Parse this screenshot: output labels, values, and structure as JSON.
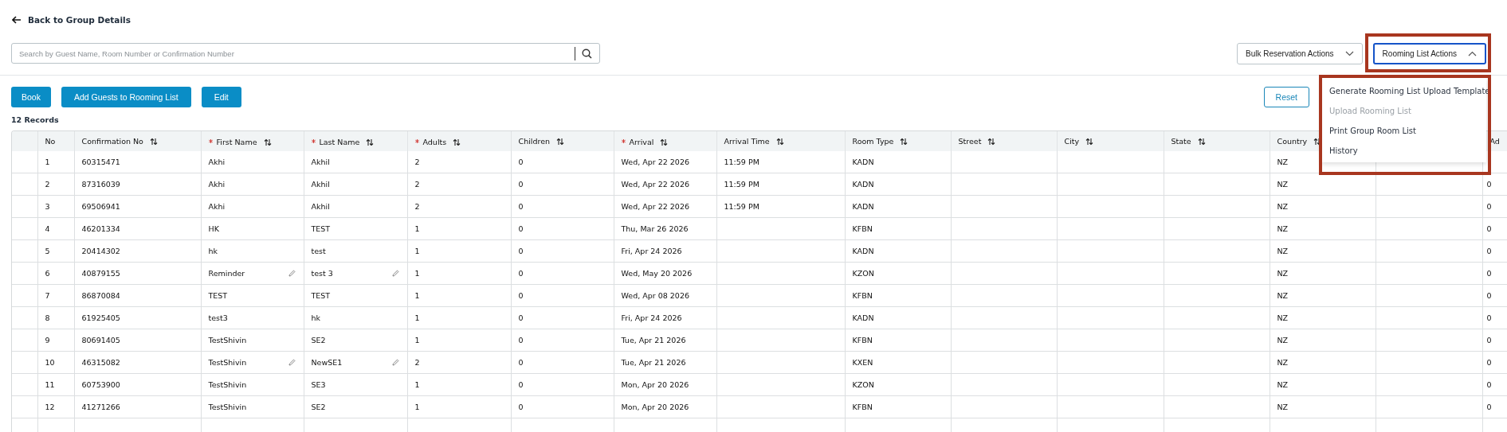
{
  "back_link": "Back to Group Details",
  "search": {
    "placeholder": "Search by Guest Name, Room Number or Confirmation Number"
  },
  "dropdowns": [
    {
      "label": "Bulk Reservation Actions",
      "expanded": false
    },
    {
      "label": "Rooming List Actions",
      "expanded": true
    }
  ],
  "menu": [
    {
      "label": "Generate Rooming List Upload Template",
      "disabled": false
    },
    {
      "label": "Upload Rooming List",
      "disabled": true
    },
    {
      "label": "Print Group Room List",
      "disabled": false
    },
    {
      "label": "History",
      "disabled": false
    }
  ],
  "buttons": [
    "Book",
    "Add Guests to Rooming List",
    "Edit"
  ],
  "reset_button": "Reset",
  "record_count": "12 Records",
  "table": {
    "columns": [
      {
        "label": "No",
        "required": false,
        "sortable": false
      },
      {
        "label": "Confirmation No",
        "required": false,
        "sortable": true
      },
      {
        "label": "First Name",
        "required": true,
        "sortable": true
      },
      {
        "label": "Last Name",
        "required": true,
        "sortable": true
      },
      {
        "label": "Adults",
        "required": true,
        "sortable": true
      },
      {
        "label": "Children",
        "required": false,
        "sortable": true
      },
      {
        "label": "Arrival",
        "required": true,
        "sortable": true
      },
      {
        "label": "Arrival Time",
        "required": false,
        "sortable": true
      },
      {
        "label": "Room Type",
        "required": false,
        "sortable": true
      },
      {
        "label": "Street",
        "required": false,
        "sortable": true
      },
      {
        "label": "City",
        "required": false,
        "sortable": true
      },
      {
        "label": "State",
        "required": false,
        "sortable": true
      },
      {
        "label": "Country",
        "required": false,
        "sortable": true
      },
      {
        "label": "Ad",
        "required": false
      }
    ],
    "rows": [
      {
        "no": "1",
        "confirmation_no": "60315471",
        "first_name": "Akhi",
        "last_name": "Akhil",
        "adults": "2",
        "children": "0",
        "arrival": "Wed, Apr 22 2026",
        "arrival_time": "11:59 PM",
        "room_type": "KADN",
        "country": "NZ",
        "editable": false
      },
      {
        "no": "2",
        "confirmation_no": "87316039",
        "first_name": "Akhi",
        "last_name": "Akhil",
        "adults": "2",
        "children": "0",
        "arrival": "Wed, Apr 22 2026",
        "arrival_time": "11:59 PM",
        "room_type": "KADN",
        "country": "NZ",
        "column_15": "0",
        "editable": false
      },
      {
        "no": "3",
        "confirmation_no": "69506941",
        "first_name": "Akhi",
        "last_name": "Akhil",
        "adults": "2",
        "children": "0",
        "arrival": "Wed, Apr 22 2026",
        "arrival_time": "11:59 PM",
        "room_type": "KADN",
        "country": "NZ",
        "column_15": "0",
        "editable": false
      },
      {
        "no": "4",
        "confirmation_no": "46201334",
        "first_name": "HK",
        "last_name": "TEST",
        "adults": "1",
        "children": "0",
        "arrival": "Thu, Mar 26 2026",
        "room_type": "KFBN",
        "country": "NZ",
        "column_15": "0",
        "editable": false
      },
      {
        "no": "5",
        "confirmation_no": "20414302",
        "first_name": "hk",
        "last_name": "test",
        "adults": "1",
        "children": "0",
        "arrival": "Fri, Apr 24 2026",
        "room_type": "KADN",
        "country": "NZ",
        "column_15": "0",
        "editable": false
      },
      {
        "no": "6",
        "confirmation_no": "40879155",
        "first_name": "Reminder",
        "last_name": "test 3",
        "adults": "1",
        "children": "0",
        "arrival": "Wed, May 20 2026",
        "room_type": "KZON",
        "country": "NZ",
        "column_15": "0",
        "editable": true
      },
      {
        "no": "7",
        "confirmation_no": "86870084",
        "first_name": "TEST",
        "last_name": "TEST",
        "adults": "1",
        "children": "0",
        "arrival": "Wed, Apr 08 2026",
        "room_type": "KFBN",
        "country": "NZ",
        "column_15": "0",
        "editable": false
      },
      {
        "no": "8",
        "confirmation_no": "61925405",
        "first_name": "test3",
        "last_name": "hk",
        "adults": "1",
        "children": "0",
        "arrival": "Fri, Apr 24 2026",
        "room_type": "KADN",
        "country": "NZ",
        "column_15": "0",
        "editable": false
      },
      {
        "no": "9",
        "confirmation_no": "80691405",
        "first_name": "TestShivin",
        "last_name": "SE2",
        "adults": "1",
        "children": "0",
        "arrival": "Tue, Apr 21 2026",
        "room_type": "KFBN",
        "country": "NZ",
        "column_15": "0",
        "editable": false
      },
      {
        "no": "10",
        "confirmation_no": "46315082",
        "first_name": "TestShivin",
        "last_name": "NewSE1",
        "adults": "2",
        "children": "0",
        "arrival": "Tue, Apr 21 2026",
        "room_type": "KXEN",
        "country": "NZ",
        "column_15": "0",
        "editable": true
      },
      {
        "no": "11",
        "confirmation_no": "60753900",
        "first_name": "TestShivin",
        "last_name": "SE3",
        "adults": "1",
        "children": "0",
        "arrival": "Mon, Apr 20 2026",
        "room_type": "KZON",
        "country": "NZ",
        "column_15": "0",
        "editable": false
      },
      {
        "no": "12",
        "confirmation_no": "41271266",
        "first_name": "TestShivin",
        "last_name": "SE2",
        "adults": "1",
        "children": "0",
        "arrival": "Mon, Apr 20 2026",
        "room_type": "KFBN",
        "country": "NZ",
        "column_15": "0",
        "editable": false
      }
    ]
  }
}
